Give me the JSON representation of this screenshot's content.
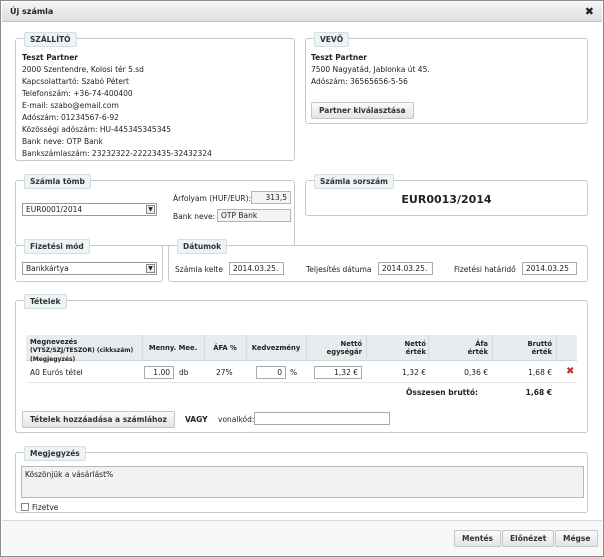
{
  "dialog": {
    "title": "Új számla",
    "close_icon": "✖"
  },
  "seller": {
    "legend": "SZÁLLÍTÓ",
    "name": "Teszt Partner",
    "address": "2000 Szentendre, Kolosi tér 5.sd",
    "contact": "Kapcsolattartó: Szabó Pétert",
    "phone": "Telefonszám: +36-74-400400",
    "email": "E-mail: szabo@email.com",
    "tax": "Adószám: 01234567-6-92",
    "eu_tax": "Közösségi adószám: HU-445345345345",
    "bank": "Bank neve: OTP Bank",
    "account": "Bankszámlaszám: 23232322-22223435-32432324"
  },
  "buyer": {
    "legend": "VEVŐ",
    "name": "Teszt Partner",
    "address": "7500 Nagyatád, Jablonka út 45.",
    "tax": "Adószám: 36565656-5-56",
    "select_button": "Partner kiválasztása"
  },
  "block": {
    "legend": "Számla tömb",
    "selected": "EUR0001/2014",
    "rate_label": "Árfolyam (HUF/EUR):",
    "rate_value": "313,5",
    "bank_label": "Bank neve:",
    "bank_value": "OTP Bank"
  },
  "serial": {
    "legend": "Számla sorszám",
    "value": "EUR0013/2014"
  },
  "payment": {
    "legend": "Fizetési mód",
    "selected": "Bankkártya"
  },
  "dates": {
    "legend": "Dátumok",
    "issue_label": "Számla kelte",
    "issue_value": "2014.03.25.",
    "fulfil_label": "Teljesítés dátuma",
    "fulfil_value": "2014.03.25.",
    "due_label": "Fizetési határidő",
    "due_value": "2014.03.25"
  },
  "items": {
    "legend": "Tételek",
    "headers": {
      "name": "Megnevezés",
      "name_sub1": "(VTSZ/SZJ/TESZOR) (cikkszám)",
      "name_sub2": "(Megjegyzés)",
      "qty": "Menny. Mee.",
      "vat": "ÁFA %",
      "discount": "Kedvezmény",
      "unit_net1": "Nettó",
      "unit_net2": "egységár",
      "net1": "Nettó",
      "net2": "érték",
      "vat_val1": "Áfa",
      "vat_val2": "érték",
      "gross1": "Bruttó",
      "gross2": "érték"
    },
    "rows": [
      {
        "name": "A0 Eurós tétel",
        "qty": "1.00",
        "unit": "db",
        "vat": "27%",
        "discount": "0",
        "discount_unit": "%",
        "unit_price": "1,32 €",
        "net": "1,32 €",
        "vat_value": "0,36 €",
        "gross": "1,68 €"
      }
    ],
    "total_label": "Összesen bruttó:",
    "total_value": "1,68 €",
    "add_button": "Tételek hozzáadása a számlához",
    "or_label": "VAGY",
    "barcode_label": "vonalkód:",
    "barcode_value": ""
  },
  "note": {
    "legend": "Megjegyzés",
    "text": "Köszönjük a vásárlást%",
    "paid_label": "Fizetve"
  },
  "footer": {
    "save": "Mentés",
    "preview": "Előnézet",
    "cancel": "Mégse"
  }
}
